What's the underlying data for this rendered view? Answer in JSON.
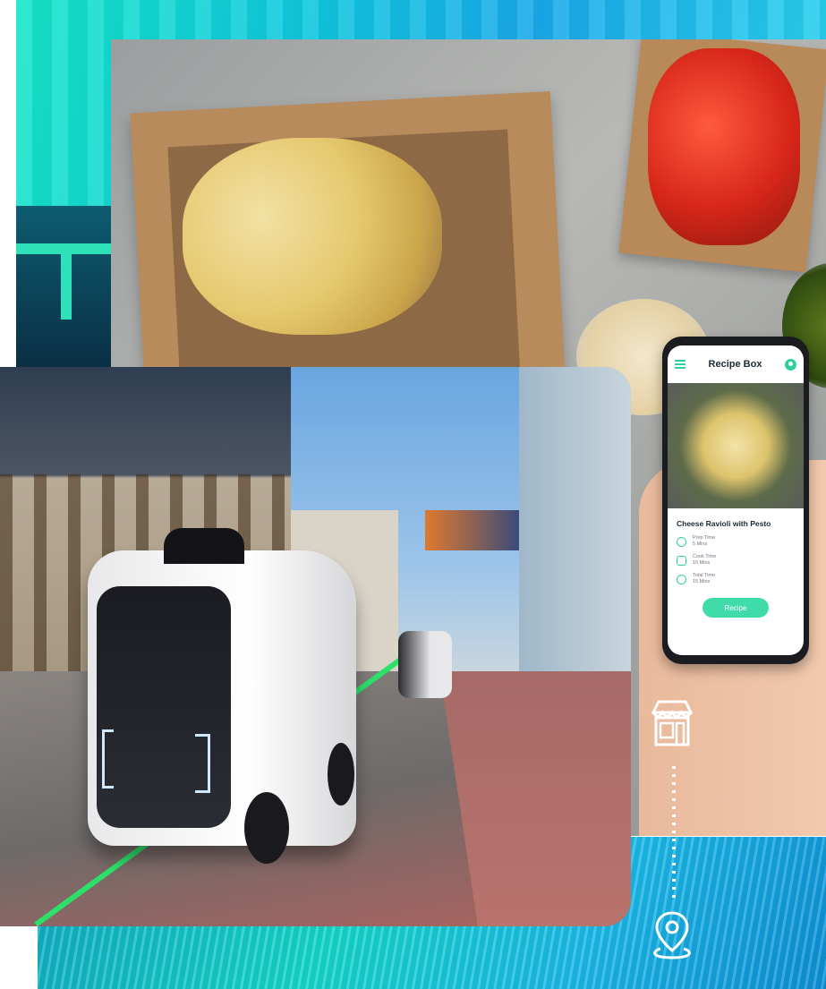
{
  "phone_app": {
    "title": "Recipe Box",
    "dish_name": "Cheese Ravioli with Pesto",
    "details": [
      {
        "label": "Prep Time",
        "value": "5 Mins"
      },
      {
        "label": "Cook Time",
        "value": "10 Mins"
      },
      {
        "label": "Total Time",
        "value": "15 Mins"
      }
    ],
    "button_label": "Recipe",
    "accent_color": "#3fdcaa"
  },
  "icons": [
    "menu-icon",
    "user-icon",
    "clock-icon",
    "pot-icon",
    "timer-icon",
    "store-icon",
    "location-pin-icon"
  ]
}
